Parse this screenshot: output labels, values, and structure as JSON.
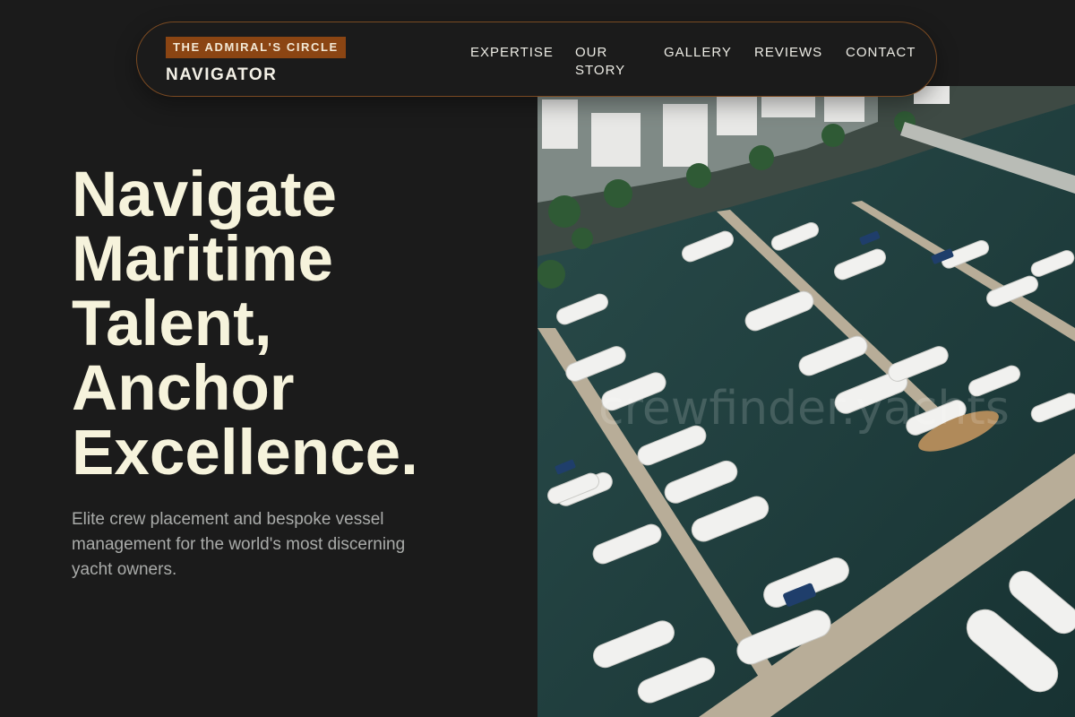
{
  "brand": {
    "tag": "THE ADMIRAL'S CIRCLE",
    "name": "NAVIGATOR"
  },
  "nav": {
    "items": [
      {
        "label": "EXPERTISE"
      },
      {
        "label": "OUR STORY"
      },
      {
        "label": "GALLERY"
      },
      {
        "label": "REVIEWS"
      },
      {
        "label": "CONTACT"
      }
    ]
  },
  "hero": {
    "title_lines": [
      "Navigate",
      "Maritime",
      "Talent,",
      "Anchor",
      "Excellence."
    ],
    "subtitle": "Elite crew placement and bespoke vessel management for the world's most discerning yacht owners."
  },
  "image": {
    "subject": "aerial-marina-photo",
    "watermark": "crewfinder.yachts"
  },
  "colors": {
    "background": "#1b1b1b",
    "accent": "#8b4513",
    "title": "#f6f3dc",
    "subtitle": "#a9aba9",
    "water": "#1d3b3b"
  }
}
